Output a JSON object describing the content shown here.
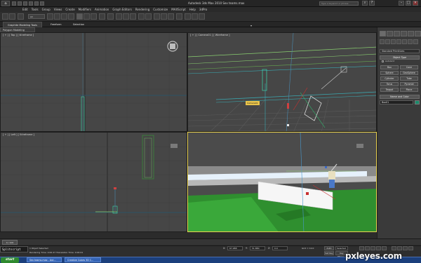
{
  "window": {
    "title": "Autodesk 3ds Max  2010     Sex teams.max",
    "search_placeholder": "Type a keyword or phrase",
    "icons": [
      "app-logo-icon",
      "minimize-icon",
      "maximize-icon",
      "close-icon"
    ]
  },
  "menubar": [
    "Edit",
    "Tools",
    "Group",
    "Views",
    "Create",
    "Modifiers",
    "Animation",
    "Graph Editors",
    "Rendering",
    "Customize",
    "MAXScript",
    "Help",
    "3dPro"
  ],
  "toolbar": {
    "selection_filter": "All"
  },
  "ribbon": {
    "tabs": [
      "Graphite Modeling Tools",
      "Freeform",
      "Selection"
    ],
    "active_tab": "Graphite Modeling Tools",
    "subpanel": "Polygon Modeling"
  },
  "viewports": {
    "top": "[ + ] [ Top ] [ Wireframe ]",
    "camera": "[ + ] [ Camera01 ] [ Wireframe ]",
    "left": "[ + ] [ Left ] [ Wireframe ]",
    "perspective": "[ + ] [ Perspective ] [ Smooth + Highlights ]",
    "camera_object_label": "Camera01"
  },
  "command_panel": {
    "category": "Standard Primitives",
    "object_type_title": "Object Type",
    "autogrid": "AutoGrid",
    "buttons": [
      "Box",
      "Cone",
      "Sphere",
      "GeoSphere",
      "Cylinder",
      "Tube",
      "Torus",
      "Pyramid",
      "Teapot",
      "Plane"
    ],
    "name_color_title": "Name and Color",
    "name_value": "Box01",
    "swatch_color": "#1a8a6a"
  },
  "timeline": {
    "slider": "0 / 100"
  },
  "status": {
    "maxscript": "Splitscript",
    "line1": "1 Object Selected",
    "line2": "Rendering Time: 0:00:47     Translation Time: 0:00:01",
    "x_label": "X:",
    "y_label": "Y:",
    "z_label": "Z:",
    "x_value": "67.988",
    "y_value": "51.880",
    "z_value": "0.0",
    "grid": "Grid = 10.0",
    "auto_key": "Auto Key",
    "selected": "Selected",
    "set_key": "Set Key",
    "key_filters": "Key Filters..."
  },
  "taskbar": {
    "start": "start",
    "tasks": [
      "Sex teams.max - Aut...",
      "Creative Cubes 3D C..."
    ]
  },
  "watermark": "pxleyes.com"
}
